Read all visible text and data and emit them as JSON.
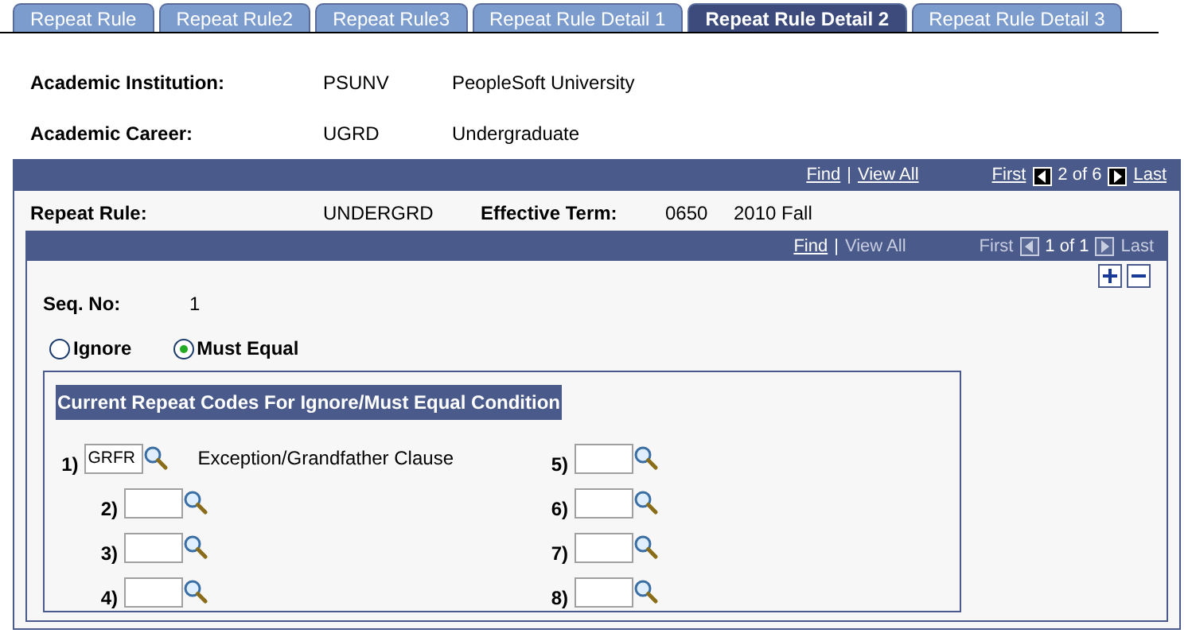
{
  "tabs": [
    {
      "label": "Repeat Rule",
      "selected": false
    },
    {
      "label": "Repeat Rule2",
      "selected": false
    },
    {
      "label": "Repeat Rule3",
      "selected": false
    },
    {
      "label": "Repeat Rule Detail 1",
      "selected": false
    },
    {
      "label": "Repeat Rule Detail 2",
      "selected": true
    },
    {
      "label": "Repeat Rule Detail 3",
      "selected": false
    }
  ],
  "header_fields": [
    {
      "label": "Academic Institution:",
      "code": "PSUNV",
      "description": "PeopleSoft University"
    },
    {
      "label": "Academic Career:",
      "code": "UGRD",
      "description": "Undergraduate"
    }
  ],
  "outer_scroll": {
    "nav": {
      "find": "Find",
      "separator": "|",
      "view_all": "View All",
      "first": "First",
      "count": "2 of 6",
      "last": "Last",
      "view_all_enabled": true,
      "first_enabled": true,
      "last_enabled": true
    },
    "repeat_rule_label": "Repeat Rule:",
    "repeat_rule": "UNDERGRD",
    "effective_term_label": "Effective Term:",
    "term_code": "0650",
    "term_description": "2010 Fall"
  },
  "inner_scroll": {
    "nav": {
      "find": "Find",
      "separator": "|",
      "view_all": "View All",
      "first": "First",
      "count": "1 of 1",
      "last": "Last",
      "view_all_enabled": false,
      "first_enabled": false,
      "last_enabled": false
    },
    "seq_label": "Seq. No:",
    "seq_value": "1",
    "radios": [
      {
        "label": "Ignore",
        "selected": false
      },
      {
        "label": "Must Equal",
        "selected": true
      }
    ],
    "group_title": "Current Repeat Codes For Ignore/Must Equal Condition",
    "codes": [
      {
        "label": "1)",
        "value": "GRFR",
        "description": "Exception/Grandfather Clause"
      },
      {
        "label": "2)"
      },
      {
        "label": "3)"
      },
      {
        "label": "4)"
      },
      {
        "label": "5)"
      },
      {
        "label": "6)"
      },
      {
        "label": "7)"
      },
      {
        "label": "8)"
      }
    ]
  }
}
